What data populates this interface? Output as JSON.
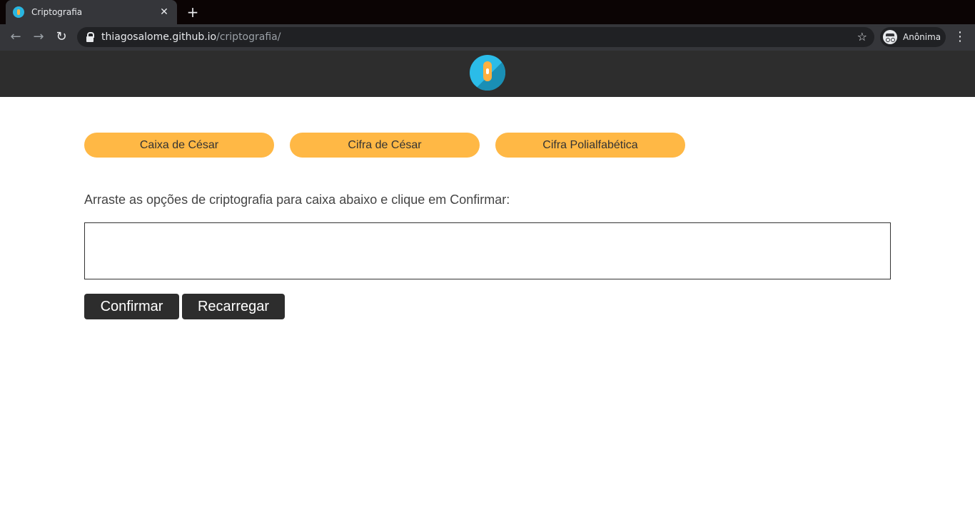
{
  "browser": {
    "tab_title": "Criptografia",
    "tab_close": "✕",
    "new_tab": "+",
    "back": "←",
    "forward": "→",
    "reload": "↻",
    "url_host": "thiagosalome.github.io",
    "url_path": "/criptografia/",
    "bookmark_star": "☆",
    "profile_label": "Anônima",
    "menu": "⋮"
  },
  "options": [
    {
      "label": "Caixa de César"
    },
    {
      "label": "Cifra de César"
    },
    {
      "label": "Cifra Polialfabética"
    }
  ],
  "instruction": "Arraste as opções de criptografia para caixa abaixo e clique em Confirmar:",
  "actions": {
    "confirm": "Confirmar",
    "reload": "Recarregar"
  },
  "colors": {
    "header_bg": "#2d2d2d",
    "option_bg": "#ffb845",
    "logo_bg": "#2bbce8"
  }
}
